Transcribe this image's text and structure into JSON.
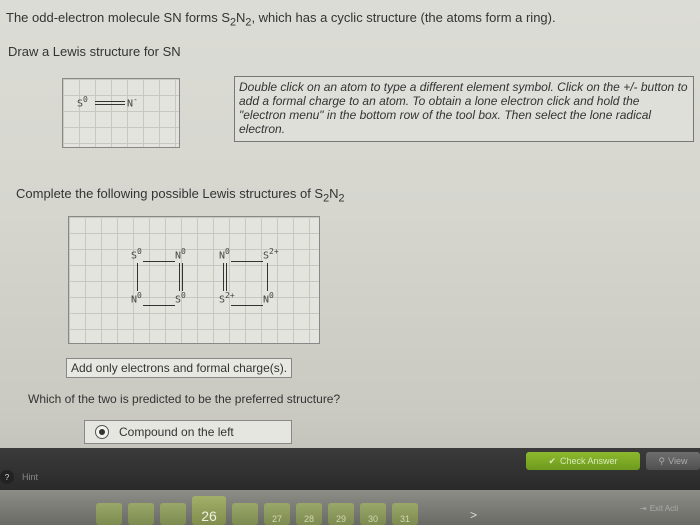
{
  "question": {
    "prefix": "The odd-electron molecule SN forms S",
    "sub1": "2",
    "mid": "N",
    "sub2": "2",
    "suffix": ", which has a cyclic structure (the atoms form a ring)."
  },
  "draw_prompt": "Draw a Lewis structure for SN",
  "sn_structure": {
    "atom1": "S",
    "charge1": "0",
    "atom2": "N",
    "charge2": "-"
  },
  "instructions": "Double click on an atom to type a different element symbol. Click on the +/- button to add a formal charge to an atom. To obtain a lone electron click and hold the \"electron menu\" in the bottom row of the tool box. Then select the lone radical electron.",
  "complete_prompt": {
    "prefix": "Complete the following possible Lewis structures of S",
    "sub1": "2",
    "mid": "N",
    "sub2": "2"
  },
  "s2n2_left": {
    "tl_atom": "S",
    "tl_charge": "0",
    "tr_atom": "N",
    "tr_charge": "0",
    "bl_atom": "N",
    "bl_charge": "0",
    "br_atom": "S",
    "br_charge": "0"
  },
  "s2n2_right": {
    "tl_atom": "N",
    "tl_charge": "0",
    "tr_atom": "S",
    "tr_charge": "2+",
    "bl_atom": "S",
    "bl_charge": "2+",
    "br_atom": "N",
    "br_charge": "0"
  },
  "add_only_label": "Add only electrons and formal charge(s).",
  "which_prompt": "Which of the two is predicted to be the preferred structure?",
  "answer": {
    "selected_label": "Compound on the left"
  },
  "toolbar": {
    "check_answer": "Check Answer",
    "view": "View",
    "hint": "Hint",
    "exit": "Exit Acti"
  },
  "pager": {
    "pages": [
      "",
      "",
      "",
      "26",
      "",
      "27",
      "28",
      "29",
      "30",
      "31"
    ],
    "current": "26",
    "next": ">"
  },
  "colors": {
    "check_green": "#7aa824",
    "pager_olive": "#8e9c5c"
  }
}
